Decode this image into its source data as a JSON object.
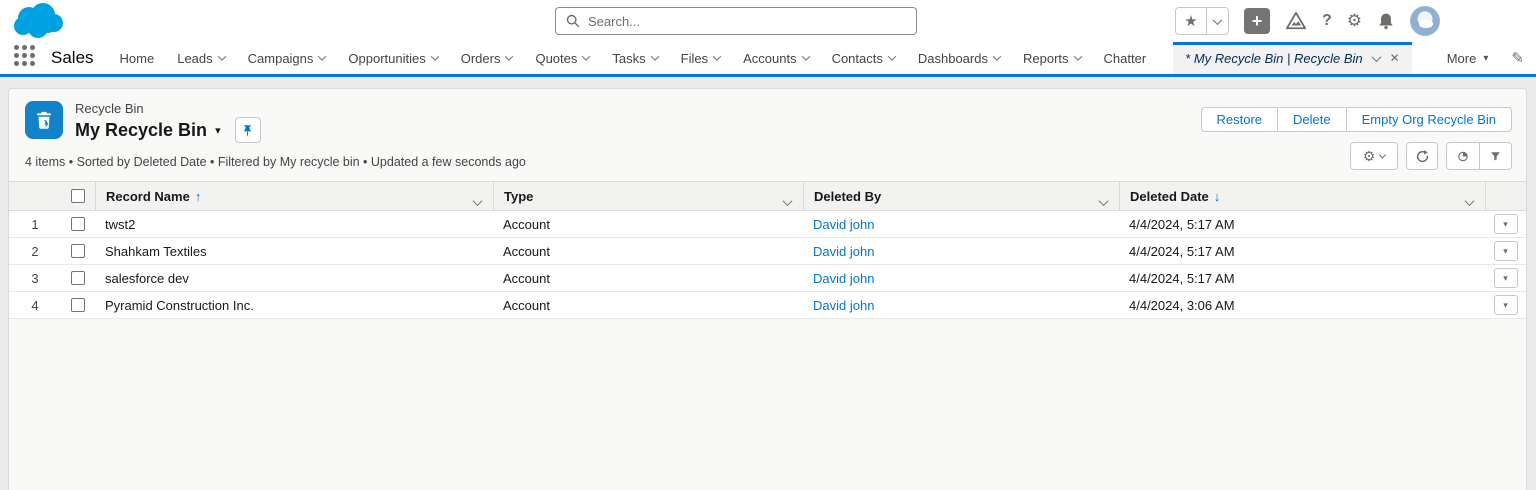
{
  "colors": {
    "brand_blue": "#0176d3",
    "logo_blue": "#00a1e0",
    "entity_icon_bg": "#1183cb",
    "link": "#0176d3"
  },
  "global_header": {
    "search_placeholder": "Search...",
    "glyphs": {
      "star": "★",
      "plus": "+",
      "help": "?",
      "gear": "⚙"
    }
  },
  "nav": {
    "app_name": "Sales",
    "tabs": [
      {
        "label": "Home"
      },
      {
        "label": "Leads"
      },
      {
        "label": "Campaigns"
      },
      {
        "label": "Opportunities"
      },
      {
        "label": "Orders"
      },
      {
        "label": "Quotes"
      },
      {
        "label": "Tasks"
      },
      {
        "label": "Files"
      },
      {
        "label": "Accounts"
      },
      {
        "label": "Contacts"
      },
      {
        "label": "Dashboards"
      },
      {
        "label": "Reports"
      },
      {
        "label": "Chatter"
      }
    ],
    "active_tab": {
      "label": "* My Recycle Bin | Recycle Bin",
      "close_glyph": "✕"
    },
    "more_label": "More",
    "more_glyph": "▾",
    "pencil_glyph": "✎"
  },
  "page_header": {
    "entity_label": "Recycle Bin",
    "title": "My Recycle Bin",
    "title_caret": "▾",
    "status_line": "4 items • Sorted by Deleted Date • Filtered by My recycle bin • Updated a few seconds ago",
    "actions": {
      "restore": "Restore",
      "delete": "Delete",
      "empty": "Empty Org Recycle Bin"
    },
    "controls_gear": "⚙"
  },
  "table": {
    "columns": {
      "record_name": "Record Name",
      "type": "Type",
      "deleted_by": "Deleted By",
      "deleted_date": "Deleted Date"
    },
    "sort_asc_glyph": "↑",
    "sort_desc_glyph": "↓",
    "action_glyph": "▾",
    "rows": [
      {
        "num": "1",
        "record_name": "twst2",
        "type": "Account",
        "deleted_by": "David john",
        "deleted_date": "4/4/2024, 5:17 AM"
      },
      {
        "num": "2",
        "record_name": "Shahkam Textiles",
        "type": "Account",
        "deleted_by": "David john",
        "deleted_date": "4/4/2024, 5:17 AM"
      },
      {
        "num": "3",
        "record_name": "salesforce dev",
        "type": "Account",
        "deleted_by": "David john",
        "deleted_date": "4/4/2024, 5:17 AM"
      },
      {
        "num": "4",
        "record_name": "Pyramid Construction Inc.",
        "type": "Account",
        "deleted_by": "David john",
        "deleted_date": "4/4/2024, 3:06 AM"
      }
    ]
  }
}
